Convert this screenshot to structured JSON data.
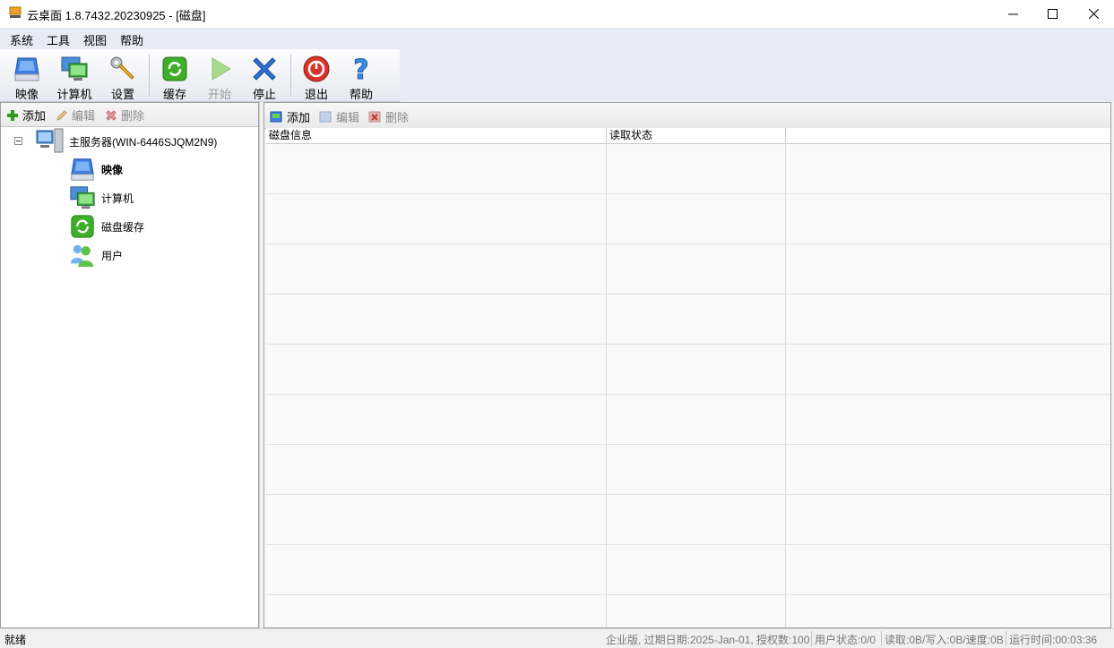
{
  "window": {
    "title": "云桌面 1.8.7432.20230925  - [磁盘]",
    "controls": [
      "minimize-icon",
      "maximize-icon",
      "close-icon"
    ]
  },
  "menu": [
    "系统",
    "工具",
    "视图",
    "帮助"
  ],
  "toolbar": {
    "buttons": [
      {
        "label": "映像",
        "icon": "image-disk-icon",
        "enabled": true
      },
      {
        "label": "计算机",
        "icon": "computer-icon",
        "enabled": true
      },
      {
        "label": "设置",
        "icon": "wrench-icon",
        "enabled": true
      },
      {
        "label": "缓存",
        "icon": "cache-refresh-icon",
        "enabled": true
      },
      {
        "label": "开始",
        "icon": "play-icon",
        "enabled": false
      },
      {
        "label": "停止",
        "icon": "stop-x-icon",
        "enabled": true
      },
      {
        "label": "退出",
        "icon": "power-icon",
        "enabled": true
      },
      {
        "label": "帮助",
        "icon": "help-question-icon",
        "enabled": true
      }
    ]
  },
  "left_toolbar": {
    "add": "添加",
    "edit": "编辑",
    "delete": "删除"
  },
  "tree": {
    "root": "主服务器(WIN-6446SJQM2N9)",
    "children": [
      "映像",
      "计算机",
      "磁盘缓存",
      "用户"
    ],
    "selected": "映像"
  },
  "right_toolbar": {
    "add": "添加",
    "edit": "编辑",
    "delete": "删除"
  },
  "grid": {
    "columns": [
      "磁盘信息",
      "读取状态",
      ""
    ],
    "rows": []
  },
  "status": {
    "ready": "就绪",
    "license": "企业版, 过期日期:2025-Jan-01, 授权数:100",
    "user_state": "用户状态:0/0",
    "io": "读取:0B/写入:0B/速度:0B",
    "uptime": "运行时间:00:03:36"
  },
  "colors": {
    "menubar": "#e8ebf6",
    "accent_blue": "#2f6fd6",
    "green": "#3fae2a",
    "red": "#d9342b"
  }
}
